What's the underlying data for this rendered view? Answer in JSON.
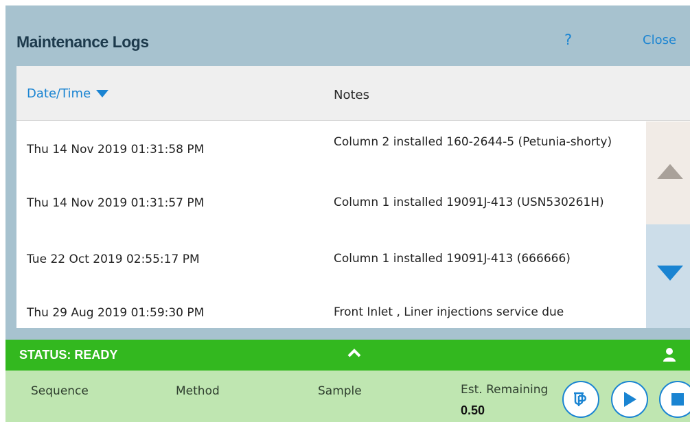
{
  "header": {
    "title": "Maintenance Logs",
    "help_label": "?",
    "close_label": "Close"
  },
  "table": {
    "columns": {
      "date": "Date/Time",
      "notes": "Notes"
    },
    "rows": [
      {
        "date": "Thu 14 Nov 2019 01:31:58 PM",
        "notes": "Column 2 installed 160-2644-5 (Petunia-shorty)"
      },
      {
        "date": "Thu 14 Nov 2019 01:31:57 PM",
        "notes": "Column 1 installed 19091J-413 (USN530261H)"
      },
      {
        "date": "Tue 22 Oct 2019 02:55:17 PM",
        "notes": "Column 1 installed 19091J-413 (666666)"
      },
      {
        "date": "Thu 29 Aug 2019 01:59:30 PM",
        "notes": "Front Inlet , Liner injections service due"
      }
    ],
    "sort_icon": "sort-descending-icon",
    "scroll_up_icon": "triangle-up-icon",
    "scroll_down_icon": "triangle-down-icon"
  },
  "status": {
    "text": "STATUS: READY",
    "expand_icon": "chevron-up-icon",
    "user_icon": "user-icon"
  },
  "info": {
    "sequence_label": "Sequence",
    "method_label": "Method",
    "sample_label": "Sample",
    "remaining_label": "Est. Remaining",
    "remaining_value": "0.50"
  },
  "controls": {
    "prep_icon": "prep-run-icon",
    "start_icon": "play-icon",
    "stop_icon": "stop-icon"
  },
  "colors": {
    "accent": "#1a84d2",
    "header_bg": "#a7c2cf",
    "status_green": "#33b81f",
    "info_green": "#bfe6b1"
  }
}
